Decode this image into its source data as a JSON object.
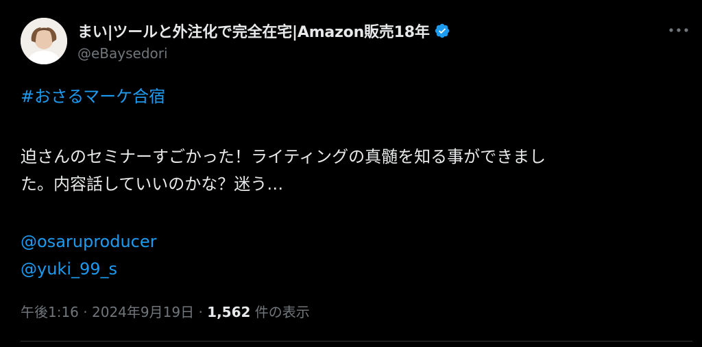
{
  "tweet": {
    "author": {
      "display_name": "まい|ツールと外注化で完全在宅|Amazon販売18年",
      "handle": "@eBaysedori",
      "verified_icon": "verified-badge-icon",
      "avatar_icon": "avatar-photo"
    },
    "more_icon": "more-options-icon",
    "hashtag": "#おさるマーケ合宿",
    "text_line_1": "迫さんのセミナーすごかった！ライティングの真髄を知る事ができまし",
    "text_line_2": "た。内容話していいのかな？迷う…",
    "mentions": [
      "@osaruproducer",
      "@yuki_99_s"
    ],
    "meta": {
      "time": "午後1:16",
      "separator": "·",
      "date": "2024年9月19日",
      "views_count": "1,562",
      "views_label": "件の表示"
    },
    "colors": {
      "background": "#000000",
      "text": "#e7e9ea",
      "secondary": "#71767b",
      "link": "#1d9bf0"
    }
  }
}
